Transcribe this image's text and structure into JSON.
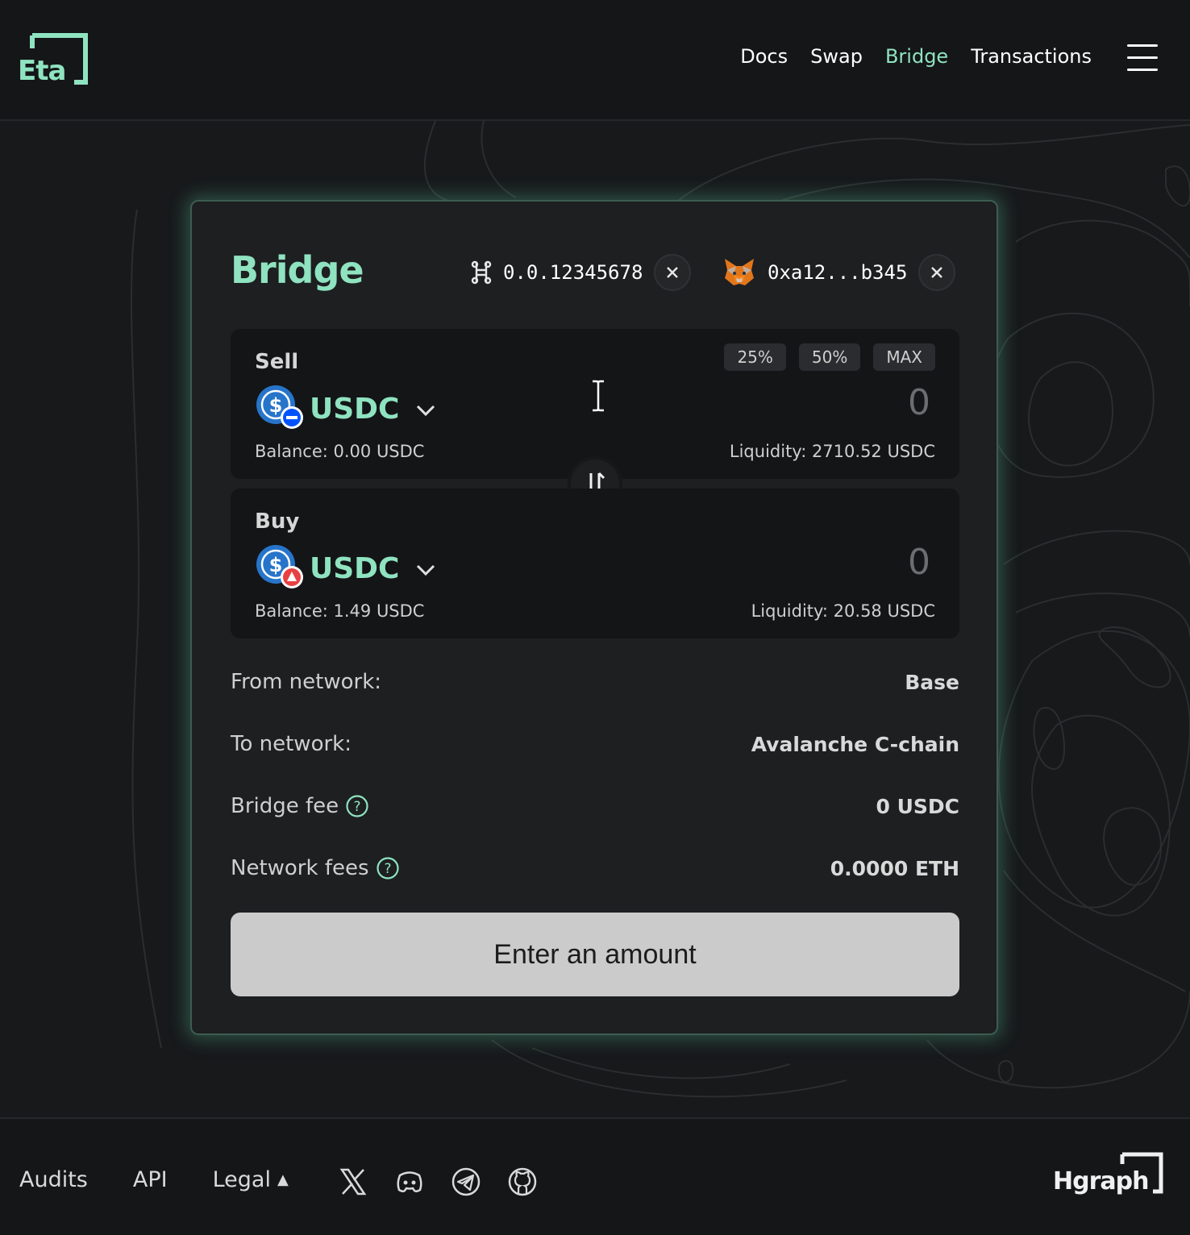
{
  "brand": {
    "logo_text": "Eta",
    "accent": "#8fe3c0"
  },
  "nav": {
    "items": [
      {
        "label": "Docs",
        "active": false
      },
      {
        "label": "Swap",
        "active": false
      },
      {
        "label": "Bridge",
        "active": true
      },
      {
        "label": "Transactions",
        "active": false
      }
    ],
    "menu_icon": "hamburger-icon"
  },
  "card": {
    "title": "Bridge",
    "hedera_wallet": {
      "icon": "hedera-icon",
      "account": "0.0.12345678"
    },
    "evm_wallet": {
      "icon": "metamask-fox-icon",
      "address": "0xa12...b345"
    }
  },
  "sell": {
    "label": "Sell",
    "token": "USDC",
    "chain_badge": "base-badge-icon",
    "amount": "0",
    "balance": "Balance: 0.00 USDC",
    "liquidity": "Liquidity: 2710.52 USDC",
    "quick_amounts": [
      "25%",
      "50%",
      "MAX"
    ]
  },
  "buy": {
    "label": "Buy",
    "token": "USDC",
    "chain_badge": "avalanche-badge-icon",
    "amount": "0",
    "balance": "Balance: 1.49 USDC",
    "liquidity": "Liquidity: 20.58 USDC"
  },
  "details": {
    "from_network": {
      "label": "From network:",
      "value": "Base"
    },
    "to_network": {
      "label": "To network:",
      "value": "Avalanche C-chain"
    },
    "bridge_fee": {
      "label": "Bridge fee",
      "value": "0 USDC"
    },
    "network_fees": {
      "label": "Network fees",
      "value": "0.0000 ETH"
    }
  },
  "cta": {
    "label": "Enter an amount"
  },
  "footer": {
    "links": [
      "Audits",
      "API",
      "Legal"
    ],
    "legal_caret": "▲",
    "socials": [
      "x-icon",
      "discord-icon",
      "telegram-icon",
      "github-icon"
    ],
    "partner": "Hgraph"
  }
}
